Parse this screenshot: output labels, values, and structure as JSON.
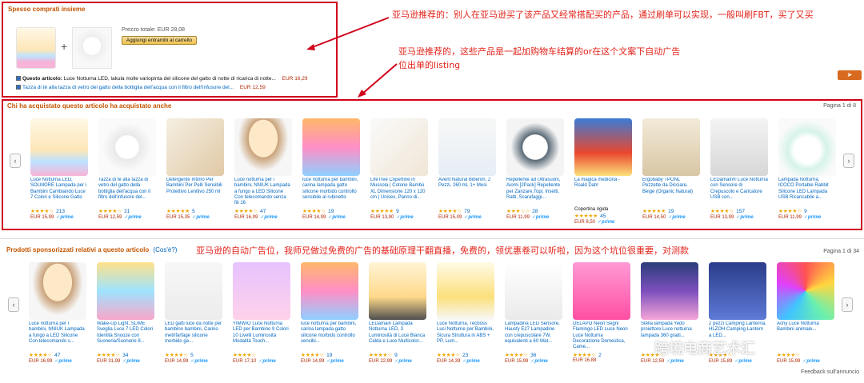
{
  "fbt": {
    "title": "Spesso comprati insieme",
    "price_label": "Prezzo totale: EUR 28,08",
    "add_button": "Aggiungi entrambi al carrello",
    "items": [
      {
        "prefix": "Questo articolo:",
        "text": "Luce Notturna LED, lakula molle variopinta del silicone del gatto di notte di ricarica di notte...",
        "price": "EUR 16,29"
      },
      {
        "prefix": "",
        "text": "Tazza di tè alla tazza di vetro del gatto della bottiglia dell'acqua con il filtro dell'infusore del...",
        "price": "EUR 12,59"
      }
    ]
  },
  "annotations": {
    "note1": "亚马逊推荐的：别人在亚马逊买了该产品又经常搭配买的产品，通过刷单可以实现，一般叫刷FBT，买了又买",
    "note2_line1": "亚马逊推荐的，这些产品是一起加购物车结算的or在这个文案下自动广告",
    "note2_line2": "位出单的listing",
    "note3": "亚马逊的自动广告位，我师兄做过免费的广告的基础原理干翻直播，免费的，领优惠卷可以听啦，因为这个坑位很重要，对测款"
  },
  "also_bought": {
    "title": "Chi ha acquistato questo articolo ha acquistato anche",
    "page": "Pagina 1 di 8",
    "prev": "‹",
    "next": "›",
    "items": [
      {
        "title": "Luce Notturna LED, SOLMORE Lampada per i Bambini Cambiando Luce 7 Colori e Silicone Gatto",
        "stars": "★★★★☆",
        "count": "213",
        "price": "EUR 15,99",
        "prime": "✓prime"
      },
      {
        "title": "Tazza di tè alla tazza di vetro del gatto della bottiglia dell'acqua con il filtro dell'infusore del...",
        "stars": "★★★★☆",
        "count": "21",
        "price": "EUR 12,59",
        "prime": "✓prime"
      },
      {
        "title": "Detergente Intimo Per Bambini Per Pelli Sensibili Protettivo Lenitivo 250 ml",
        "stars": "★★★★★",
        "count": "5",
        "price": "EUR 15,35",
        "prime": "✓prime"
      },
      {
        "title": "Luce notturna per i bambini, NNIUK Lampada a fungo a LED Silicone Con telecomando senza fili 16",
        "stars": "★★★★☆",
        "count": "47",
        "price": "EUR 16,99",
        "prime": "✓prime"
      },
      {
        "title": "luce notturna per bambini, carina lampada gatto silicone morbido controllo sensibile al rubinetto",
        "stars": "★★★★☆",
        "count": "19",
        "price": "EUR 14,99",
        "prime": "✓prime"
      },
      {
        "title": "LifeTree Copertine in Mussola | Cotone Bambù XL Dimensione 120 x 120 cm | Unisex, Panno di...",
        "stars": "★★★★★",
        "count": "9",
        "price": "EUR 13,90",
        "prime": "✓prime"
      },
      {
        "title": "Avent Natural Biberon, 2 Pezzi, 260 ml, 1+ Mesi",
        "stars": "★★★★☆",
        "count": "79",
        "price": "EUR 15,09",
        "prime": "✓prime"
      },
      {
        "title": "Repellente ad Ultrasuoni, Aiomi [2Pack] Repellente per Zanzare,Topi, Insetti, Ratti, Scarafaggi...",
        "stars": "★★★☆☆",
        "count": "28",
        "price": "EUR 11,99",
        "prime": "✓prime"
      },
      {
        "title": "La magica medicina - Roald Dahl",
        "stars": "★★★★★",
        "count": "45",
        "price": "EUR 8,50",
        "prime": "✓prime",
        "extra": "Copertina rigida"
      },
      {
        "title": "Ergobaby TPONL Pezzette da Dicciare, Beige (Organic Natural)",
        "stars": "★★★★★",
        "count": "19",
        "price": "EUR 14,50",
        "prime": "✓prime"
      },
      {
        "title": "LEDamain® Luce Notturna con Sensore di Crepuscolo e Caricatore USB con...",
        "stars": "★★★★☆",
        "count": "157",
        "price": "EUR 13,99",
        "prime": "✓prime"
      },
      {
        "title": "Lampada Notturna, ICOCO Portable Rabbit Silicone LED Lampada USB Ricaricabile a...",
        "stars": "★★★★☆",
        "count": "9",
        "price": "EUR 11,99",
        "prime": "✓prime"
      }
    ]
  },
  "sponsored": {
    "title": "Prodotti sponsorizzati relativi a questo articolo",
    "title_suffix": "(Cos'è?)",
    "page": "Pagina 1 di 34",
    "prev": "‹",
    "next": "›",
    "feedback": "Feedback sull'annuncio",
    "items": [
      {
        "title": "Luce notturna per i bambini, NNIUK Lampada a fungo a LED Silicone Con telecomando s...",
        "stars": "★★★★☆",
        "count": "47",
        "price": "EUR 16,99",
        "prime": "✓prime"
      },
      {
        "title": "Wake-Up Light, SLIME Sveglia Luce 7 LED Colori Identità Snooze con Suoneria/Suonerie 8...",
        "stars": "★★★★☆",
        "count": "34",
        "price": "EUR 31,99",
        "prime": "✓prime"
      },
      {
        "title": "LED gatti luce da notte per bambino bambini, Carino metrifarfage silicone morbido ga...",
        "stars": "★★★★☆",
        "count": "5",
        "price": "EUR 14,99",
        "prime": "✓prime"
      },
      {
        "title": "YIMWIO Luce Notturna LED per Bambino 9 Colori 10 Livelli Luminosità Modalità Touch...",
        "stars": "★★★★☆",
        "count": "",
        "price": "EUR 17,10",
        "prime": "✓prime"
      },
      {
        "title": "luce notturna per bambini, carina lampada gatto silicone morbido controllo sensibi...",
        "stars": "★★★★☆",
        "count": "19",
        "price": "EUR 14,99",
        "prime": "✓prime"
      },
      {
        "title": "LEDamain Lampada Notturna LED, 3 Luminosità di Luce Bianca Calda e Luce Multicolor...",
        "stars": "★★★★☆",
        "count": "9",
        "price": "EUR 22,99",
        "prime": "✓prime"
      },
      {
        "title": "Luce Notturna, Tecboss Luci Notturne per Bambini, Sicura Struttura in ABS + PP, Lum...",
        "stars": "★★★★☆",
        "count": "23",
        "price": "EUR 14,39",
        "prime": "✓prime"
      },
      {
        "title": "Lampadina LED Sensore, Hausfy E27 Lampadine con crepuscolare 7W, equivalenti a 60 Wat...",
        "stars": "★★★★☆",
        "count": "36",
        "price": "EUR 15,99",
        "prime": "✓prime"
      },
      {
        "title": "DELAPO Neon Segni Flamingo LED Luce Neon Luce Notturna Decorazione Domestica, Came...",
        "stars": "★★★★☆",
        "count": "2",
        "price": "EUR 16,88",
        "prime": ""
      },
      {
        "title": "Stella lampada Yedo proiettore Luce notturna lampada 360 gradi...",
        "stars": "★★★★☆",
        "count": "",
        "price": "EUR 12,59",
        "prime": "✓prime"
      },
      {
        "title": "2 pezzi Camping Lanterna, HLZOH Camping Lantern a LED...",
        "stars": "★★★★☆",
        "count": "",
        "price": "EUR 15,89",
        "prime": "✓prime"
      },
      {
        "title": "Achy Luce Notturna Bambini animale...",
        "stars": "★★★★☆",
        "count": "",
        "price": "EUR 15,99",
        "prime": "✓prime"
      }
    ]
  },
  "watermark": "跨境电商艺术汇",
  "share": "➤",
  "colors": {
    "accent_red": "#d0021b",
    "section_title": "#c45500",
    "link": "#0066c0",
    "price": "#b12704"
  }
}
